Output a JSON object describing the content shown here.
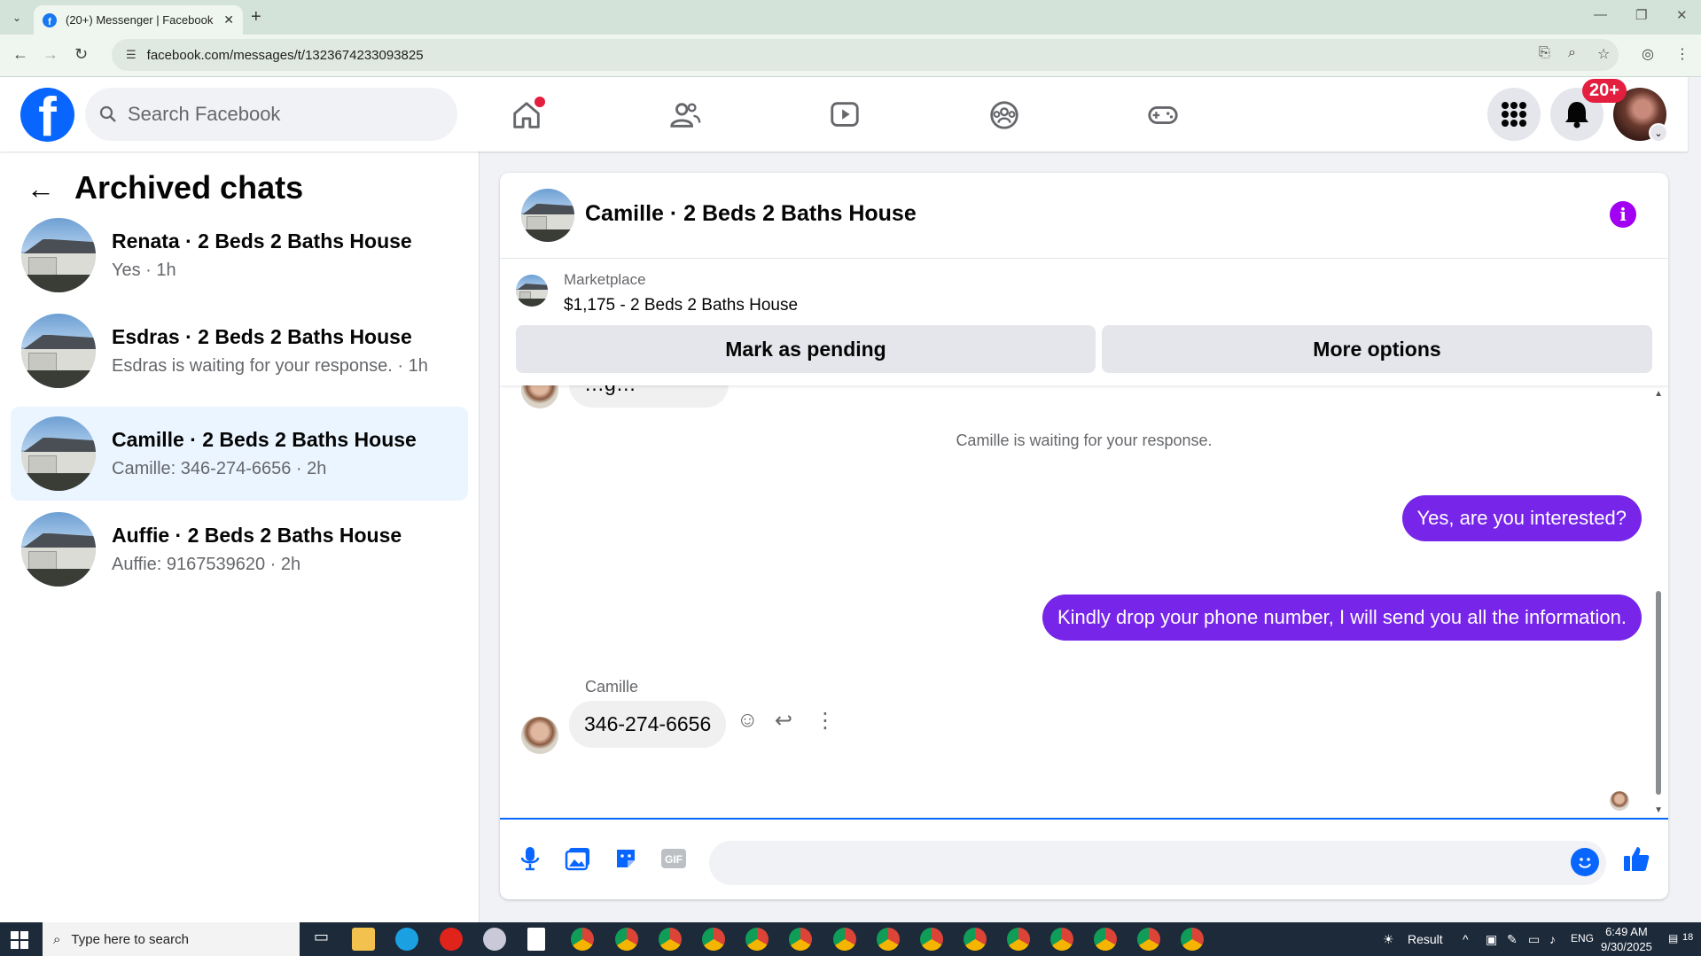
{
  "browser": {
    "tab_title": "(20+) Messenger | Facebook",
    "url": "facebook.com/messages/t/1323674233093825"
  },
  "header": {
    "search_placeholder": "Search Facebook",
    "notification_badge": "20+"
  },
  "left_panel": {
    "title": "Archived chats",
    "chats": [
      {
        "name": "Renata · 2 Beds 2 Baths House",
        "preview": "Yes · 1h",
        "active": false
      },
      {
        "name": "Esdras · 2 Beds 2 Baths House",
        "preview": "Esdras is waiting for your response. · 1h",
        "active": false
      },
      {
        "name": "Camille · 2 Beds 2 Baths House",
        "preview": "Camille: 346-274-6656 · 2h",
        "active": true
      },
      {
        "name": "Auffie · 2 Beds 2 Baths House",
        "preview": "Auffie: 9167539620 · 2h",
        "active": false
      }
    ]
  },
  "conversation": {
    "title": "Camille · 2 Beds 2 Baths House",
    "marketplace_label": "Marketplace",
    "listing": "$1,175 - 2 Beds 2 Baths House",
    "mark_pending_label": "Mark as pending",
    "more_options_label": "More options",
    "system_message": "Camille is waiting for your response.",
    "outgoing": [
      "Yes, are you interested?",
      "Kindly drop your phone number, I will send you all the information."
    ],
    "incoming_sender": "Camille",
    "incoming_message": "346-274-6656",
    "partial_message": "…g…"
  },
  "taskbar": {
    "search_text": "Type here to search",
    "weather_label": "Result",
    "lang": "ENG",
    "time": "6:49 AM",
    "date": "9/30/2025",
    "notifications": "18"
  },
  "colors": {
    "fb_blue": "#0866ff",
    "outgoing_bubble": "#7625e9",
    "active_chat_bg": "#ebf5ff",
    "info_icon": "#a100f2"
  }
}
